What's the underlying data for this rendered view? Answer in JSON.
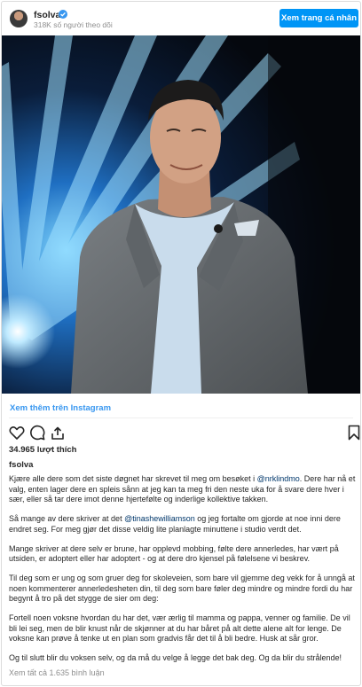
{
  "header": {
    "username": "fsolva",
    "followers": "318K số người theo dõi",
    "view_profile_label": "Xem trang cá nhân"
  },
  "post": {
    "view_more_label": "Xem thêm trên Instagram",
    "likes": "34.965 lượt thích",
    "caption_username": "fsolva",
    "caption": {
      "p1_before": "Kjære alle dere som det siste døgnet har skrevet til meg om besøket i ",
      "p1_mention": "@nrklindmo",
      "p1_after": ". Dere har nå et valg, enten lager dere en spleis sånn at jeg kan ta meg fri den neste uka for å svare dere hver i sær, eller så tar dere imot denne hjertefølte og inderlige kollektive takken.",
      "p2_before": "Så mange av dere skriver at det ",
      "p2_mention": "@tinashewilliamson",
      "p2_after": " og jeg fortalte om gjorde at noe inni dere endret seg. For meg gjør det disse veldig lite planlagte minuttene i studio verdt det.",
      "p3": "Mange skriver at dere selv er brune, har opplevd mobbing, følte dere annerledes, har vært på utsiden, er adoptert eller har adoptert - og at dere dro kjensel på følelsene vi beskrev.",
      "p4": "Til deg som er ung og som gruer deg for skoleveien, som bare vil gjemme deg vekk for å unngå at noen kommenterer annerledesheten din, til deg som bare føler deg mindre og mindre fordi du har begynt å tro på det stygge de sier om deg:",
      "p5": "Fortell noen voksne hvordan du har det, vær ærlig til mamma og pappa, venner og familie. De vil bli lei seg, men de blir knust når de skjønner at du har båret på alt dette alene alt for lenge. De voksne kan prøve å tenke ut en plan som gradvis får det til å bli bedre. Husk at sår gror.",
      "p6": "Og til slutt blir du voksen selv, og da må du velge å legge det bak deg. Og da blir du strålende!"
    },
    "view_comments_label": "Xem tất cả 1.635 bình luận"
  },
  "colors": {
    "accent": "#3897f0",
    "button": "#0095f6",
    "mention": "#00376b",
    "muted": "#8e8e8e"
  },
  "icons": [
    "verified-badge-icon",
    "heart-icon",
    "comment-icon",
    "share-icon",
    "bookmark-icon"
  ]
}
